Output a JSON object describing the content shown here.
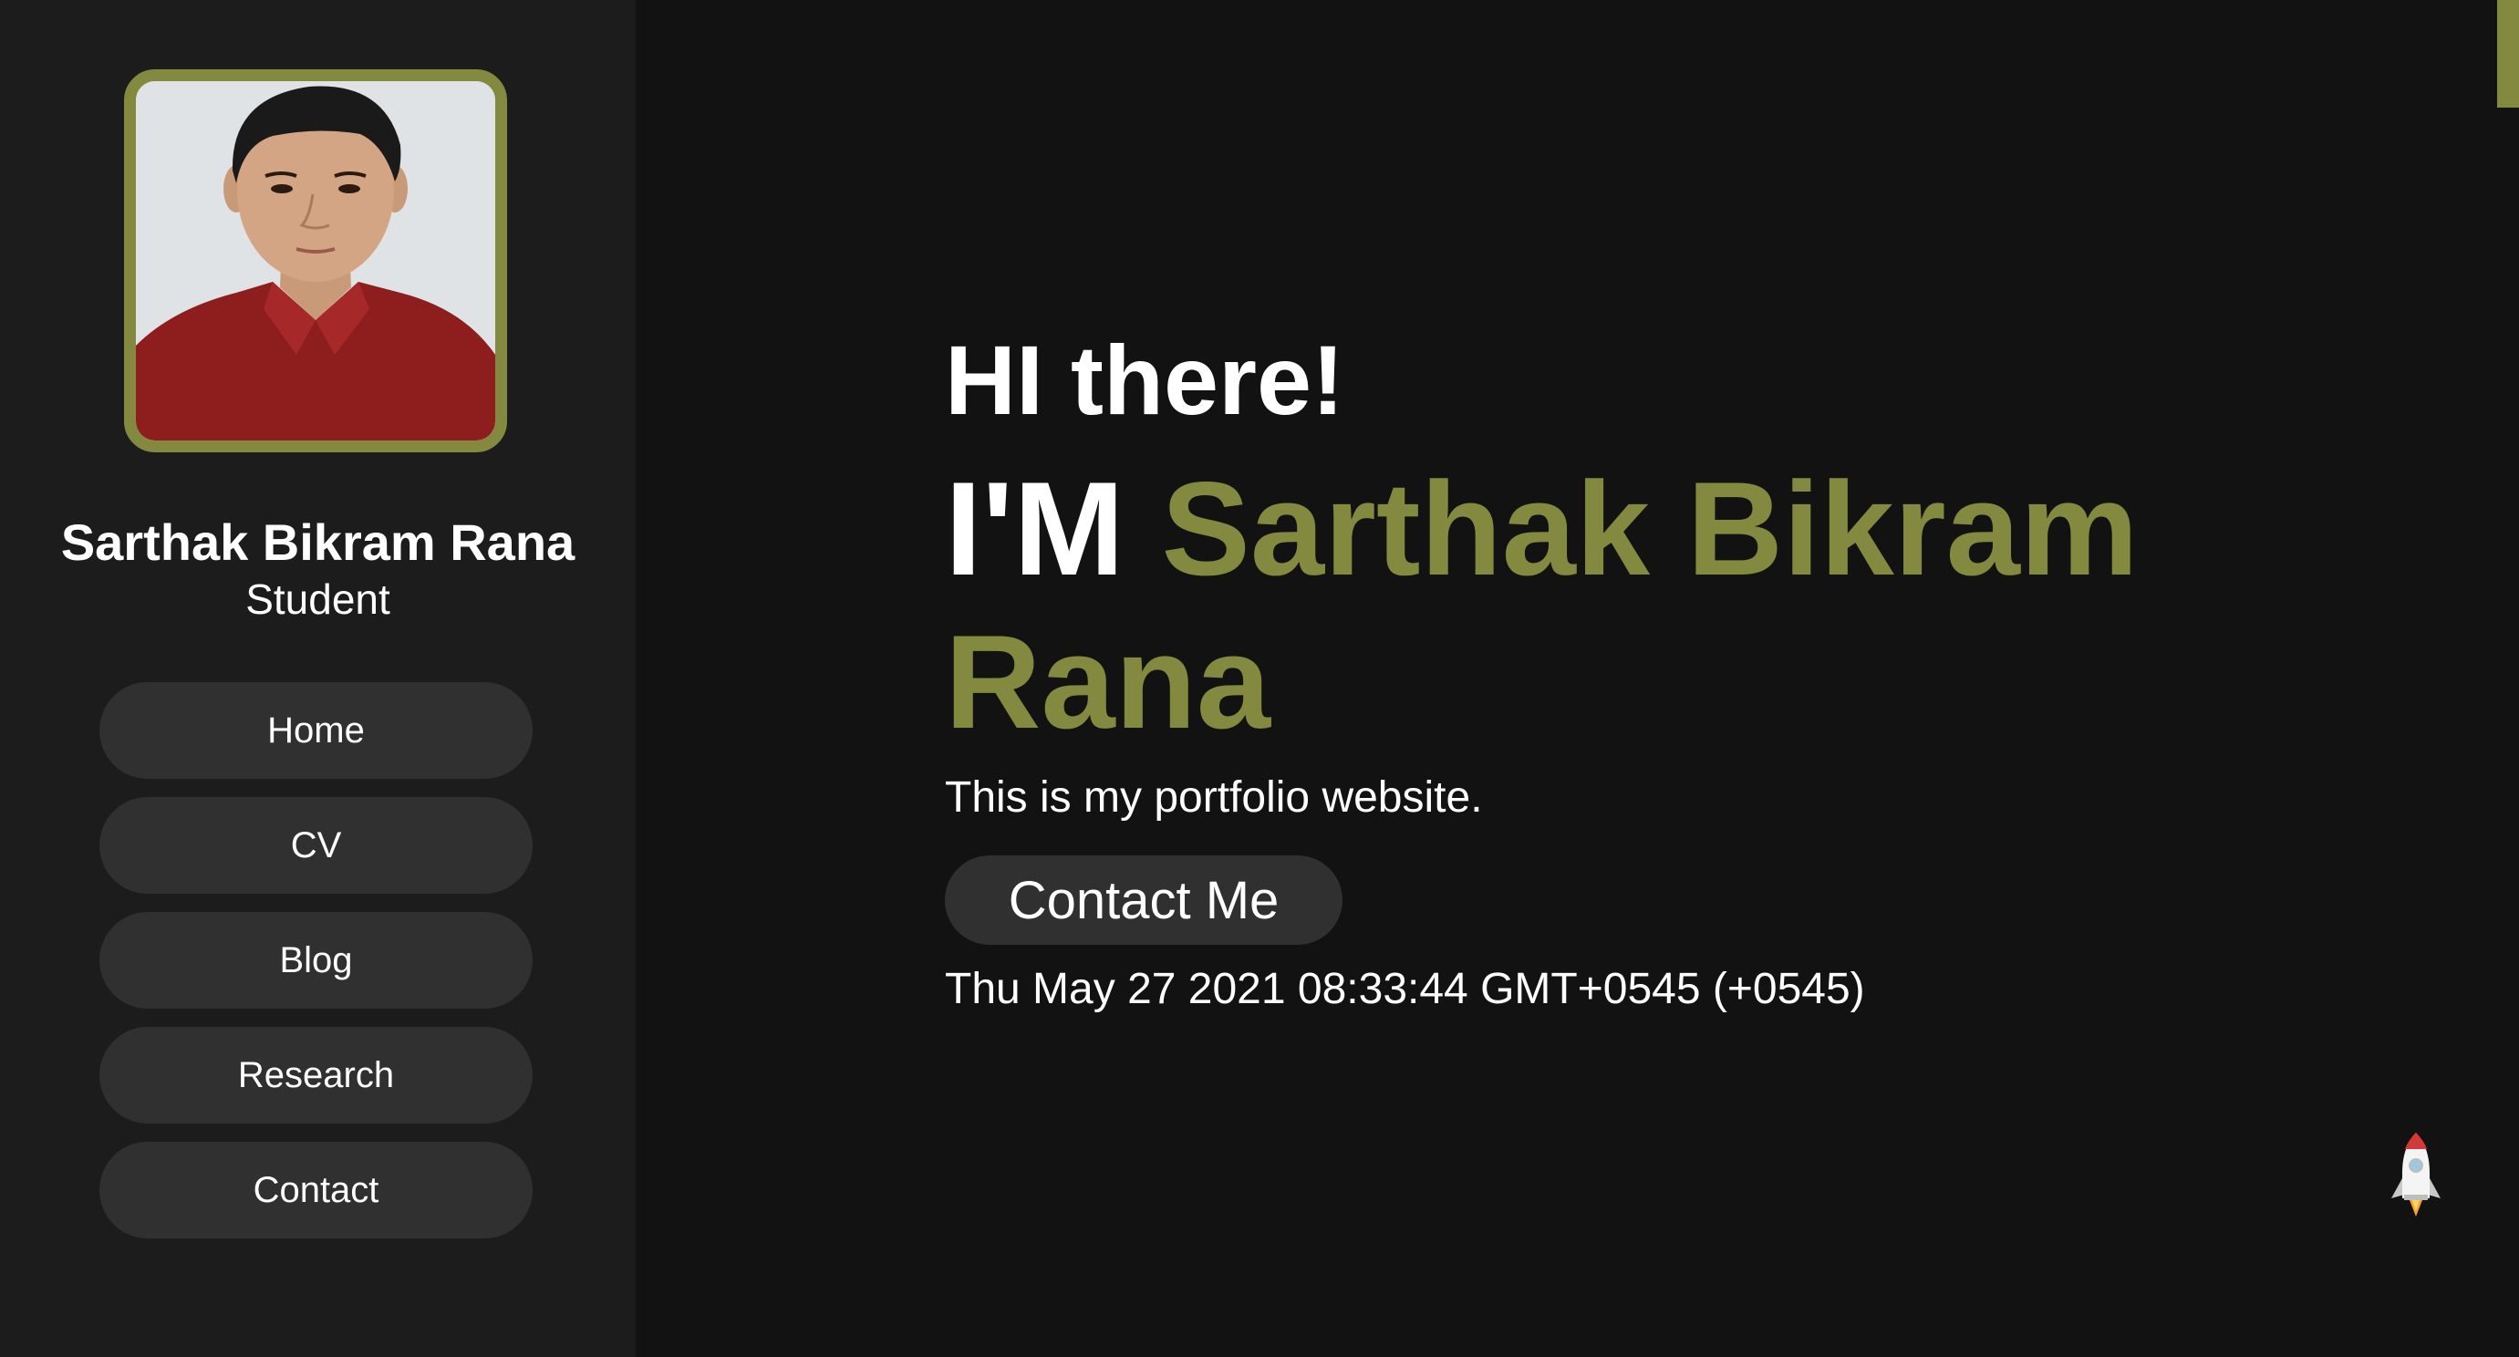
{
  "profile": {
    "name": "Sarthak Bikram Rana",
    "role": "Student",
    "photo_icon": "profile-photo"
  },
  "nav": {
    "items": [
      {
        "label": "Home"
      },
      {
        "label": "CV"
      },
      {
        "label": "Blog"
      },
      {
        "label": "Research"
      },
      {
        "label": "Contact"
      }
    ]
  },
  "hero": {
    "greeting": "HI there!",
    "intro_prefix": "I'M",
    "intro_name": "Sarthak Bikram Rana",
    "tagline": "This is my portfolio website.",
    "contact_button": "Contact Me",
    "datetime": "Thu May 27 2021 08:33:44 GMT+0545 (+0545)"
  },
  "widgets": {
    "back_to_top_icon": "rocket-icon"
  },
  "colors": {
    "accent": "#838a40",
    "background": "#121212",
    "sidebar": "#1c1c1c",
    "button": "#303030",
    "text": "#ffffff"
  }
}
